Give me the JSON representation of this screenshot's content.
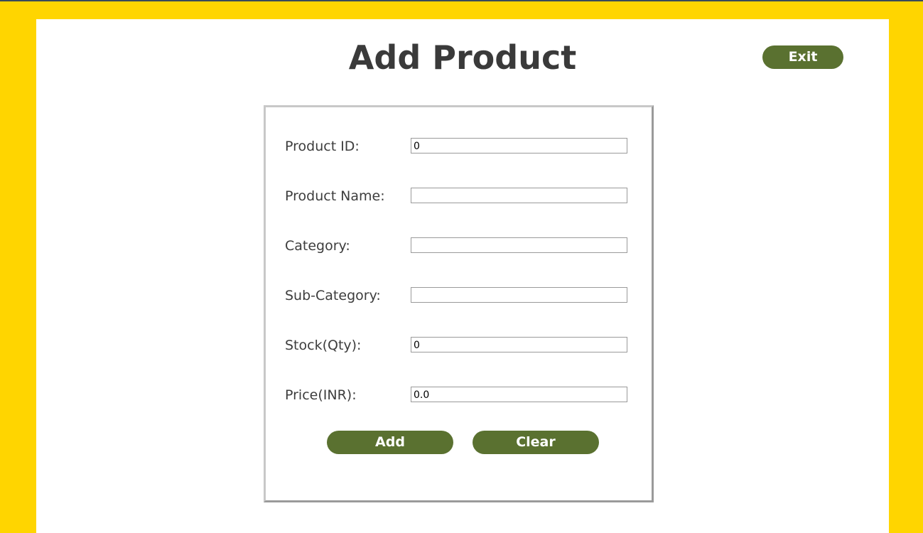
{
  "page": {
    "title": "Add Product"
  },
  "toolbar": {
    "exit_label": "Exit"
  },
  "form": {
    "fields": [
      {
        "label": "Product ID:",
        "value": "0"
      },
      {
        "label": "Product Name:",
        "value": ""
      },
      {
        "label": "Category:",
        "value": ""
      },
      {
        "label": "Sub-Category:",
        "value": ""
      },
      {
        "label": "Stock(Qty):",
        "value": "0"
      },
      {
        "label": "Price(INR):",
        "value": "0.0"
      }
    ],
    "add_label": "Add",
    "clear_label": "Clear"
  },
  "colors": {
    "background": "#FFD500",
    "panel": "#FFFFFF",
    "button": "#5A7130",
    "title_text": "#3A3A3A"
  }
}
